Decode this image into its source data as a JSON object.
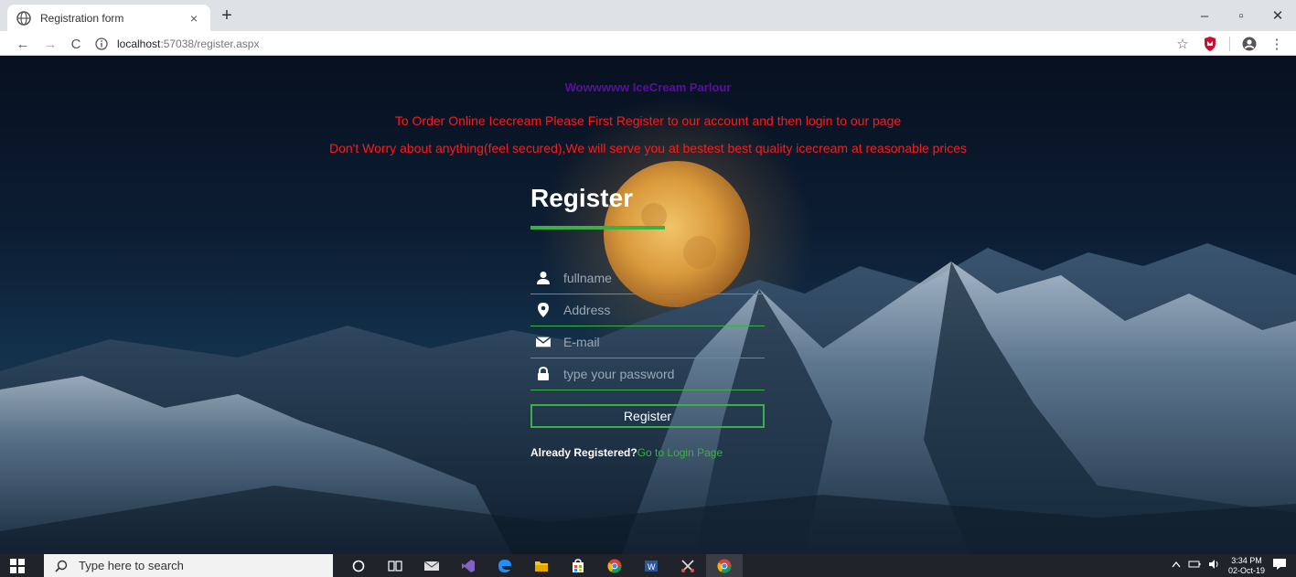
{
  "browser": {
    "tab_title": "Registration form",
    "tab_close": "×",
    "new_tab": "+",
    "url_host": "localhost",
    "url_path": ":57038/register.aspx",
    "window_controls": {
      "minimize": "–",
      "maximize": "▫",
      "close": "✕"
    },
    "nav": {
      "back": "←",
      "forward": "→",
      "reload": "C"
    },
    "icons": {
      "bookmark": "☆",
      "menu": "⋮"
    }
  },
  "page": {
    "site_title": "Wowwwww IceCream Parlour",
    "notice_line1": "To Order Online Icecream Please First Register to our account and then login to our page",
    "notice_line2": "Don't Worry about anything(feel secured),We will serve you at bestest best quality icecream at reasonable prices",
    "form": {
      "heading": "Register",
      "fields": [
        {
          "icon": "user-icon",
          "placeholder": "fullname"
        },
        {
          "icon": "location-pin-icon",
          "placeholder": "Address"
        },
        {
          "icon": "envelope-icon",
          "placeholder": "E-mail"
        },
        {
          "icon": "lock-icon",
          "placeholder": "type your password"
        }
      ],
      "submit_label": "Register",
      "already_text": "Already Registered?",
      "login_link": "Go to Login Page"
    },
    "colors": {
      "accent": "#3cb043",
      "notice": "#ff1a1a",
      "site_title": "#5b0ea0"
    }
  },
  "taskbar": {
    "search_placeholder": "Type here to search",
    "time": "3:34 PM",
    "date": "02-Oct-19"
  }
}
